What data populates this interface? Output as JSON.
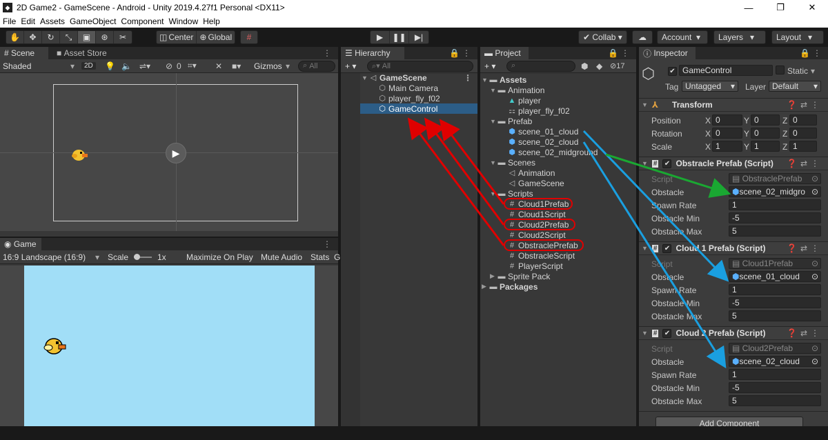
{
  "window": {
    "title": "2D Game2 - GameScene - Android - Unity 2019.4.27f1 Personal <DX11>",
    "controls": [
      "—",
      "❐",
      "✕"
    ]
  },
  "menu": [
    "File",
    "Edit",
    "Assets",
    "GameObject",
    "Component",
    "Window",
    "Help"
  ],
  "toolbar": {
    "pivot": "Center",
    "space": "Global",
    "collab": "Collab",
    "account": "Account",
    "layers": "Layers",
    "layout": "Layout"
  },
  "scene_panel": {
    "tab_scene": "Scene",
    "tab_asset_store": "Asset Store",
    "shading": "Shaded",
    "mode_2d": "2D",
    "hidden_count": "0",
    "gizmos": "Gizmos",
    "search_placeholder": "All"
  },
  "game_panel": {
    "tab": "Game",
    "resolution": "16:9 Landscape (16:9)",
    "scale_label": "Scale",
    "scale_value": "1x",
    "maximize": "Maximize On Play",
    "mute": "Mute Audio",
    "stats": "Stats",
    "gizmos_cut": "G"
  },
  "hierarchy": {
    "tab": "Hierarchy",
    "search_placeholder": "All",
    "scene": "GameScene",
    "objects": [
      "Main Camera",
      "player_fly_f02",
      "GameControl"
    ]
  },
  "project": {
    "tab": "Project",
    "hidden_count": "17",
    "assets": "Assets",
    "animation": "Animation",
    "anim_items": [
      "player",
      "player_fly_f02"
    ],
    "prefab": "Prefab",
    "prefab_items": [
      "scene_01_cloud",
      "scene_02_cloud",
      "scene_02_midground"
    ],
    "scenes": "Scenes",
    "scene_items": [
      "Animation",
      "GameScene"
    ],
    "scripts": "Scripts",
    "script_items": [
      "Cloud1Prefab",
      "Cloud1Script",
      "Cloud2Prefab",
      "Cloud2Script",
      "ObstraclePrefab",
      "ObstracleScript",
      "PlayerScript"
    ],
    "sprite_pack": "Sprite Pack",
    "packages": "Packages"
  },
  "inspector": {
    "tab": "Inspector",
    "object_name": "GameControl",
    "static": "Static",
    "tag_label": "Tag",
    "tag_value": "Untagged",
    "layer_label": "Layer",
    "layer_value": "Default",
    "transform": {
      "title": "Transform",
      "rows": [
        {
          "label": "Position",
          "x": "0",
          "y": "0",
          "z": "0"
        },
        {
          "label": "Rotation",
          "x": "0",
          "y": "0",
          "z": "0"
        },
        {
          "label": "Scale",
          "x": "1",
          "y": "1",
          "z": "1"
        }
      ]
    },
    "components": [
      {
        "title": "Obstracle Prefab (Script)",
        "script": "ObstraclePrefab",
        "obstacle": "scene_02_midgro",
        "spawn_rate": "1",
        "min": "-5",
        "max": "5"
      },
      {
        "title": "Cloud 1 Prefab (Script)",
        "script": "Cloud1Prefab",
        "obstacle": "scene_01_cloud",
        "spawn_rate": "1",
        "min": "-5",
        "max": "5"
      },
      {
        "title": "Cloud 2 Prefab (Script)",
        "script": "Cloud2Prefab",
        "obstacle": "scene_02_cloud",
        "spawn_rate": "1",
        "min": "-5",
        "max": "5"
      }
    ],
    "labels": {
      "script": "Script",
      "obstacle": "Obstacle",
      "spawn_rate": "Spawn Rate",
      "min": "Obstacle Min",
      "max": "Obstacle Max"
    },
    "add_component": "Add Component"
  },
  "annotation_colors": {
    "red": "#e00000",
    "blue": "#1a9fe0",
    "green": "#1aa832"
  }
}
